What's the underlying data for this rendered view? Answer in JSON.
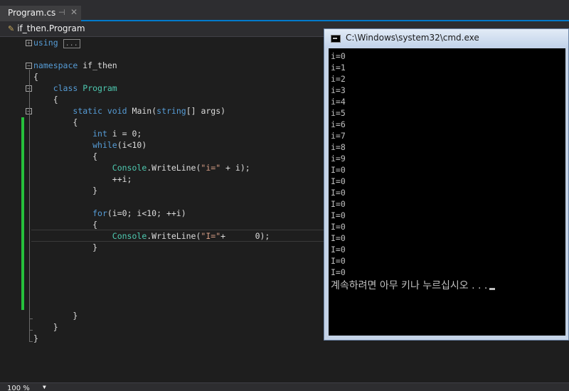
{
  "tab": {
    "label": "Program.cs",
    "pin": "⊣",
    "close": "✕"
  },
  "nav": {
    "class_path": "if_then.Program"
  },
  "code": {
    "using_kw": "using",
    "using_collapsed": "...",
    "namespace_kw": "namespace",
    "namespace_name": "if_then",
    "open_brace": "{",
    "close_brace": "}",
    "class_kw": "class",
    "class_name": "Program",
    "static_kw": "static",
    "void_kw": "void",
    "method_name": "Main(",
    "string_kw": "string",
    "args_tail": "[] args)",
    "int_kw": "int",
    "int_tail": " i = 0;",
    "while_kw": "while",
    "while_tail": "(i<10)",
    "console_type": "Console",
    "writeline1_mid": ".WriteLine(",
    "str1": "\"i=\"",
    "writeline1_tail": " + i);",
    "inc": "++i;",
    "for_kw": "for",
    "for_tail": "(i=0; i<10; ++i)",
    "writeline2_mid": ".WriteLine(",
    "str2": "\"I=\"",
    "writeline2_tail": "+      0);"
  },
  "status": {
    "zoom": "100 %",
    "zoom_arrow": "▼"
  },
  "console": {
    "title": "C:\\Windows\\system32\\cmd.exe",
    "lines": [
      "i=0",
      "i=1",
      "i=2",
      "i=3",
      "i=4",
      "i=5",
      "i=6",
      "i=7",
      "i=8",
      "i=9",
      "I=0",
      "I=0",
      "I=0",
      "I=0",
      "I=0",
      "I=0",
      "I=0",
      "I=0",
      "I=0",
      "I=0"
    ],
    "prompt": "계속하려면 아무 키나 누르십시오 . . ."
  }
}
